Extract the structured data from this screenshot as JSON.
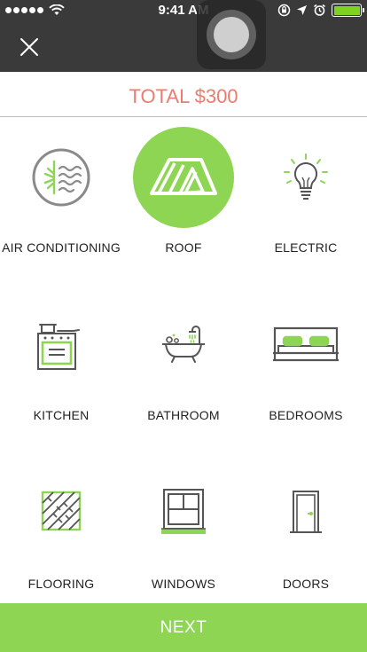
{
  "status_bar": {
    "time": "9:41 AM",
    "battery_color": "#7ed321"
  },
  "header": {
    "close_icon": "close-icon"
  },
  "total": {
    "text": "TOTAL $300",
    "color": "#ec7c6e"
  },
  "categories": [
    {
      "label": "AIR CONDITIONING",
      "icon": "air-conditioning-icon",
      "selected": false
    },
    {
      "label": "ROOF",
      "icon": "roof-icon",
      "selected": true
    },
    {
      "label": "ELECTRIC",
      "icon": "lightbulb-icon",
      "selected": false
    },
    {
      "label": "KITCHEN",
      "icon": "stove-icon",
      "selected": false
    },
    {
      "label": "BATHROOM",
      "icon": "bathtub-icon",
      "selected": false
    },
    {
      "label": "BEDROOMS",
      "icon": "bed-icon",
      "selected": false
    },
    {
      "label": "FLOORING",
      "icon": "flooring-icon",
      "selected": false
    },
    {
      "label": "WINDOWS",
      "icon": "window-icon",
      "selected": false
    },
    {
      "label": "DOORS",
      "icon": "door-icon",
      "selected": false
    }
  ],
  "next_button": {
    "label": "NEXT",
    "color": "#8dd553"
  },
  "accent_green": "#8dd553"
}
